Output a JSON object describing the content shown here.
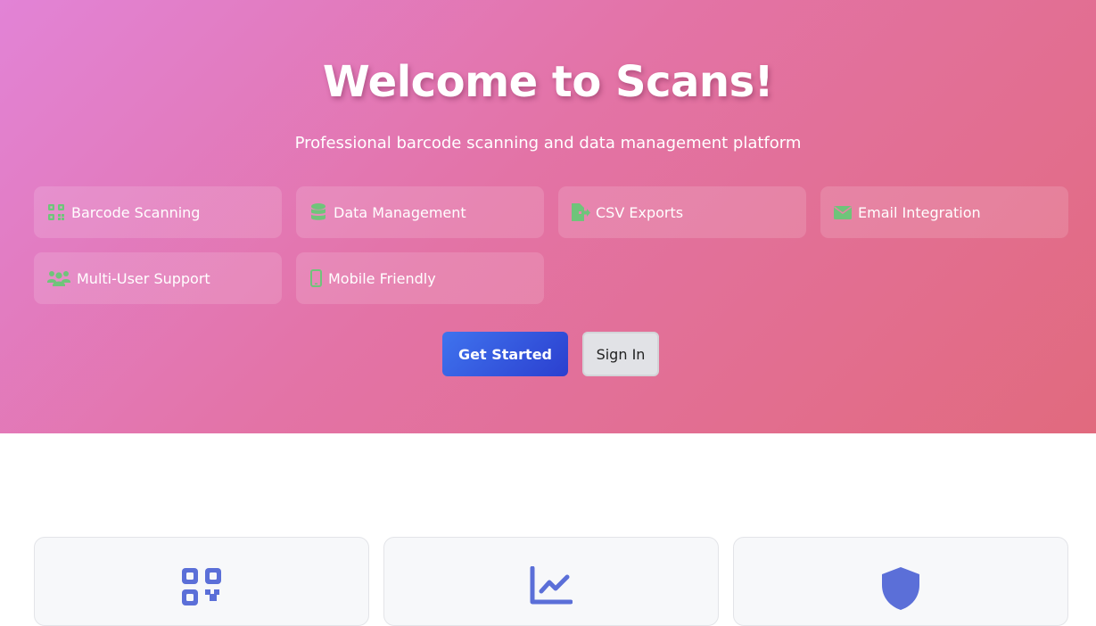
{
  "hero": {
    "title": "Welcome to Scans!",
    "subtitle": "Professional barcode scanning and data management platform"
  },
  "features": [
    {
      "label": "Barcode Scanning",
      "icon": "qrcode-icon"
    },
    {
      "label": "Data Management",
      "icon": "database-icon"
    },
    {
      "label": "CSV Exports",
      "icon": "file-export-icon"
    },
    {
      "label": "Email Integration",
      "icon": "envelope-icon"
    },
    {
      "label": "Multi-User Support",
      "icon": "users-icon"
    },
    {
      "label": "Mobile Friendly",
      "icon": "mobile-icon"
    }
  ],
  "actions": {
    "primary_label": "Get Started",
    "secondary_label": "Sign In"
  },
  "cards": [
    {
      "icon": "qrcode-icon"
    },
    {
      "icon": "chart-line-icon"
    },
    {
      "icon": "shield-icon"
    }
  ],
  "colors": {
    "feature_icon": "#6fc47a",
    "card_icon": "#5b6fd8",
    "primary_button": "#3550dc"
  }
}
